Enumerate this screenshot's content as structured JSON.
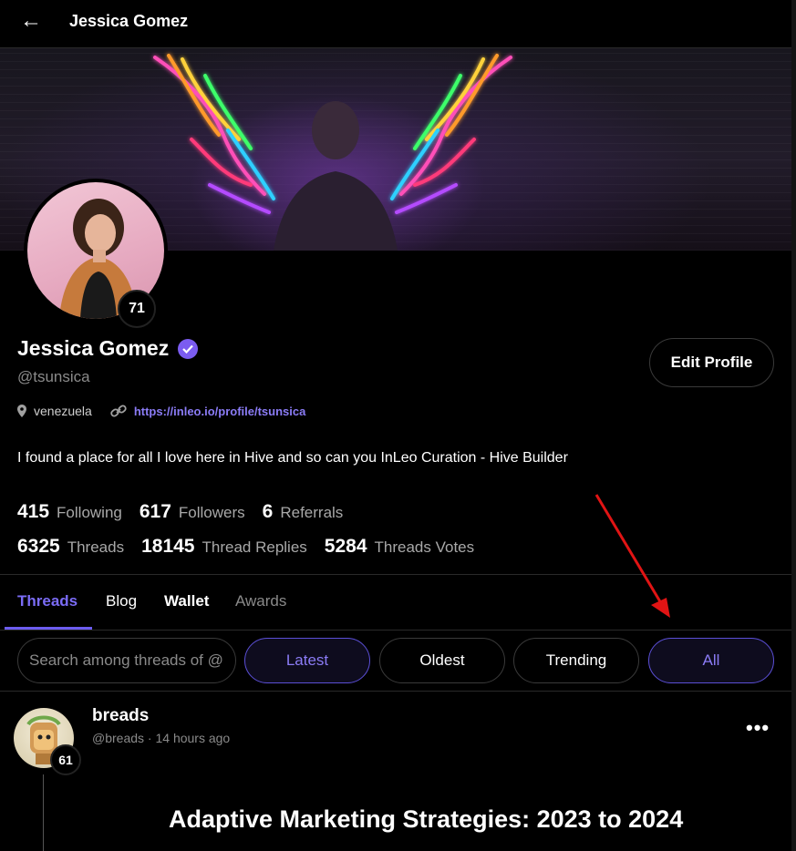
{
  "header": {
    "back_icon": "arrow-left-icon",
    "title": "Jessica Gomez"
  },
  "profile": {
    "name": "Jessica Gomez",
    "handle": "@tsunsica",
    "level": "71",
    "location": "venezuela",
    "link": "https://inleo.io/profile/tsunsica",
    "bio": "I found a place for all I love here in Hive and so can you InLeo Curation - Hive Builder",
    "edit_button": "Edit Profile",
    "accent_color": "#7b5cf0"
  },
  "stats_row1": [
    {
      "value": "415",
      "label": "Following"
    },
    {
      "value": "617",
      "label": "Followers"
    },
    {
      "value": "6",
      "label": "Referrals"
    }
  ],
  "stats_row2": [
    {
      "value": "6325",
      "label": "Threads"
    },
    {
      "value": "18145",
      "label": "Thread Replies"
    },
    {
      "value": "5284",
      "label": "Threads Votes"
    }
  ],
  "tabs": [
    {
      "label": "Threads",
      "active": true
    },
    {
      "label": "Blog"
    },
    {
      "label": "Wallet"
    },
    {
      "label": "Awards"
    }
  ],
  "filters": {
    "search_placeholder": "Search among threads of @",
    "latest": "Latest",
    "oldest": "Oldest",
    "trending": "Trending",
    "all": "All"
  },
  "post": {
    "author": "breads",
    "handle": "@breads",
    "separator": "·",
    "time": "14 hours ago",
    "level": "61",
    "more_icon": "more-horizontal-icon",
    "title": "Adaptive Marketing Strategies: 2023 to 2024"
  },
  "annotation": {
    "arrow_color": "#e11414"
  }
}
